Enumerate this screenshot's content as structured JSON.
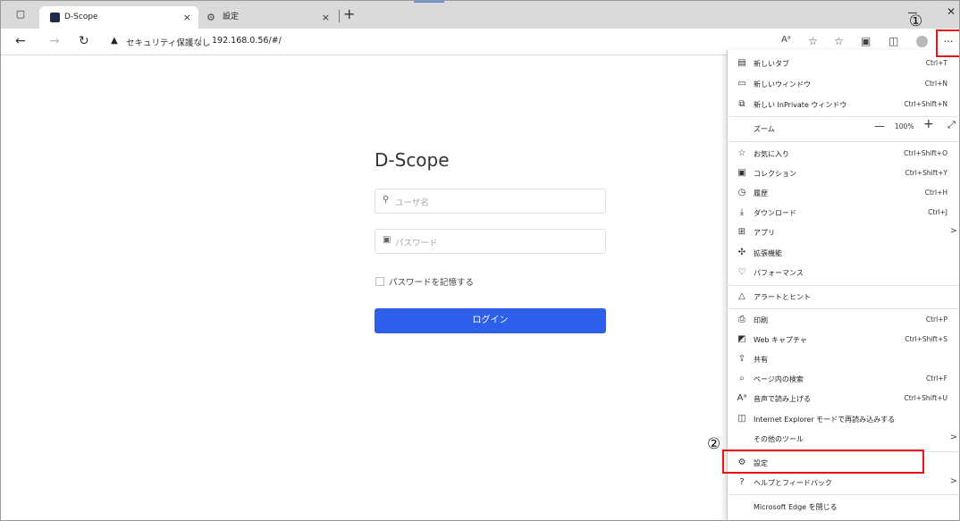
{
  "tabs": [
    {
      "label": "D-Scope",
      "close": "×"
    },
    {
      "label": "設定",
      "close": "×"
    }
  ],
  "newtab": "+",
  "window": {
    "minimize": "－",
    "close": "✕"
  },
  "address": {
    "warning_icon": "warning-icon",
    "security_text": "セキュリティ保護なし",
    "divider": "|",
    "url": "192.168.0.56/#/"
  },
  "toolbar_icons": [
    "read-aloud-icon",
    "favorite-add-icon",
    "favorites-icon",
    "collections-icon",
    "browser-essentials-icon",
    "profile-icon",
    "more-icon"
  ],
  "login": {
    "title": "D-Scope",
    "username_placeholder": "ユーザ名",
    "password_placeholder": "パスワード",
    "remember_label": "パスワードを記憶する",
    "login_button": "ログイン"
  },
  "menu": {
    "items": [
      {
        "label": "新しいタブ",
        "shortcut": "Ctrl+T",
        "icon": "new-tab-icon"
      },
      {
        "label": "新しいウィンドウ",
        "shortcut": "Ctrl+N",
        "icon": "new-window-icon"
      },
      {
        "label": "新しい InPrivate ウィンドウ",
        "shortcut": "Ctrl+Shift+N",
        "icon": "inprivate-icon"
      },
      {
        "label": "ズーム",
        "shortcut": "",
        "icon": ""
      },
      {
        "label": "お気に入り",
        "shortcut": "Ctrl+Shift+O",
        "icon": "favorites-icon"
      },
      {
        "label": "コレクション",
        "shortcut": "Ctrl+Shift+Y",
        "icon": "collections-icon"
      },
      {
        "label": "履歴",
        "shortcut": "Ctrl+H",
        "icon": "history-icon"
      },
      {
        "label": "ダウンロード",
        "shortcut": "Ctrl+J",
        "icon": "download-icon"
      },
      {
        "label": "アプリ",
        "shortcut": "",
        "icon": "apps-icon",
        "arrow": ">"
      },
      {
        "label": "拡張機能",
        "shortcut": "",
        "icon": "extensions-icon"
      },
      {
        "label": "パフォーマンス",
        "shortcut": "",
        "icon": "performance-icon"
      },
      {
        "label": "アラートとヒント",
        "shortcut": "",
        "icon": "bell-icon"
      },
      {
        "label": "印刷",
        "shortcut": "Ctrl+P",
        "icon": "print-icon"
      },
      {
        "label": "Web キャプチャ",
        "shortcut": "Ctrl+Shift+S",
        "icon": "web-capture-icon"
      },
      {
        "label": "共有",
        "shortcut": "",
        "icon": "share-icon"
      },
      {
        "label": "ページ内の検索",
        "shortcut": "Ctrl+F",
        "icon": "find-icon"
      },
      {
        "label": "音声で読み上げる",
        "shortcut": "Ctrl+Shift+U",
        "icon": "read-aloud-icon"
      },
      {
        "label": "Internet Explorer モードで再読み込みする",
        "shortcut": "",
        "icon": "ie-mode-icon"
      },
      {
        "label": "その他のツール",
        "shortcut": "",
        "icon": "",
        "arrow": ">"
      },
      {
        "label": "設定",
        "shortcut": "",
        "icon": "gear-icon"
      },
      {
        "label": "ヘルプとフィードバック",
        "shortcut": "",
        "icon": "help-icon",
        "arrow": ">"
      },
      {
        "label": "Microsoft Edge を閉じる",
        "shortcut": "",
        "icon": ""
      }
    ],
    "zoom_value": "100%",
    "zoom_minus": "—",
    "zoom_plus": "+",
    "zoom_fullscreen": "⤢"
  },
  "annotations": {
    "step1": "①",
    "step2": "②"
  },
  "colors": {
    "accent": "#2d60ea",
    "annotation": "#e8131a"
  }
}
